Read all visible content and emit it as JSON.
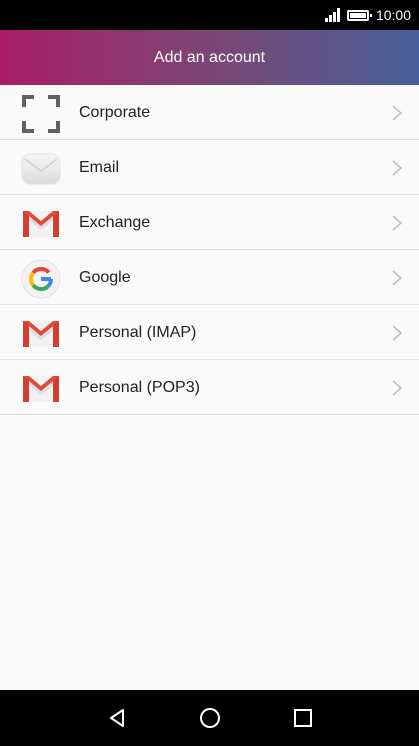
{
  "status_bar": {
    "time": "10:00",
    "icons": [
      "signal-icon",
      "battery-icon"
    ]
  },
  "header": {
    "title": "Add an account",
    "colors": [
      "#a81f63",
      "#46609a"
    ]
  },
  "accounts": [
    {
      "label": "Corporate",
      "icon": "corporate-icon"
    },
    {
      "label": "Email",
      "icon": "email-envelope-icon"
    },
    {
      "label": "Exchange",
      "icon": "gmail-m-icon"
    },
    {
      "label": "Google",
      "icon": "google-g-icon"
    },
    {
      "label": "Personal (IMAP)",
      "icon": "gmail-m-icon"
    },
    {
      "label": "Personal (POP3)",
      "icon": "gmail-m-icon"
    }
  ],
  "nav_bar": {
    "icons": [
      "back-icon",
      "home-icon",
      "recents-icon"
    ]
  }
}
